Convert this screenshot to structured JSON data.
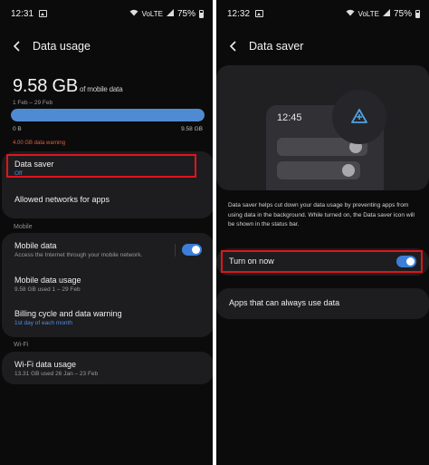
{
  "left": {
    "status": {
      "time": "12:31",
      "battery": "75%",
      "signal": "VoLTE"
    },
    "header": {
      "title": "Data usage"
    },
    "summary": {
      "amount": "9.58 GB",
      "unit": "of mobile data",
      "period": "1 Feb – 29 Feb"
    },
    "usage_bar": {
      "fill_fraction": 1.0,
      "min_label": "0 B",
      "max_label": "9.58 GB",
      "warning": "4.00 GB data warning"
    },
    "data_saver": {
      "label": "Data saver",
      "value": "Off"
    },
    "allowed_networks": {
      "label": "Allowed networks for apps"
    },
    "mobile_section": "Mobile",
    "mobile_data": {
      "label": "Mobile data",
      "sub": "Access the Internet through your mobile network.",
      "enabled": true
    },
    "mobile_data_usage": {
      "label": "Mobile data usage",
      "sub": "9.58 GB used 1 – 29 Feb"
    },
    "billing": {
      "label": "Billing cycle and data warning",
      "sub": "1st day of each month"
    },
    "wifi_section": "Wi-Fi",
    "wifi_usage": {
      "label": "Wi-Fi data usage",
      "sub": "13.31 GB used 26 Jan – 23 Feb"
    }
  },
  "right": {
    "status": {
      "time": "12:32",
      "battery": "75%",
      "signal": "VoLTE"
    },
    "header": {
      "title": "Data saver"
    },
    "illustration": {
      "time": "12:45"
    },
    "description": "Data saver helps cut down your data usage by preventing apps from using data in the background. While turned on, the Data saver icon will be shown in the status bar.",
    "turn_on": {
      "label": "Turn on now",
      "enabled": true
    },
    "unrestricted_apps": {
      "label": "Apps that can always use data"
    }
  },
  "colors": {
    "accent": "#3d7ed8",
    "highlight": "#e0141e",
    "warning": "#d9653a",
    "bar": "#4f8bd2"
  }
}
